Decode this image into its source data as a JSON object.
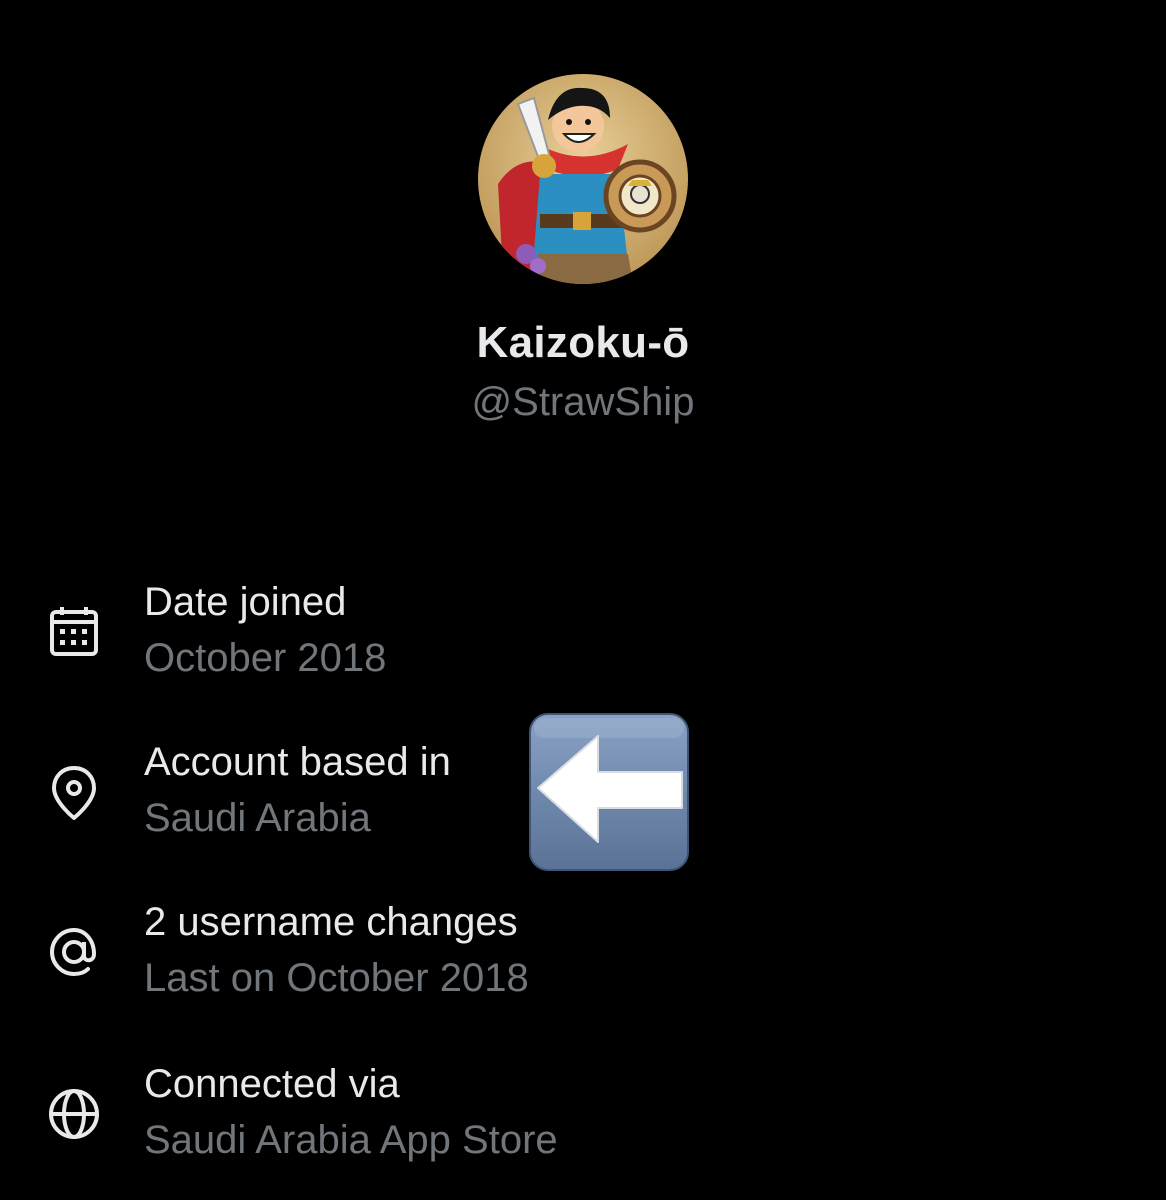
{
  "profile": {
    "display_name": "Kaizoku-ō",
    "handle": "@StrawShip",
    "avatar": "anime-pirate-avatar"
  },
  "info": {
    "date_joined": {
      "icon": "calendar-icon",
      "title": "Date joined",
      "value": "October 2018"
    },
    "location": {
      "icon": "location-pin-icon",
      "title": "Account based in",
      "value": "Saudi Arabia"
    },
    "username_changes": {
      "icon": "at-sign-icon",
      "title": "2 username changes",
      "value": "Last on October 2018"
    },
    "connected_via": {
      "icon": "globe-icon",
      "title": "Connected via",
      "value": "Saudi Arabia App Store"
    }
  },
  "overlay": {
    "icon": "left-arrow-emoji"
  },
  "colors": {
    "background": "#000000",
    "primary_text": "#e7e9ea",
    "secondary_text": "#71767b",
    "arrow_button": "#6d87ab"
  }
}
